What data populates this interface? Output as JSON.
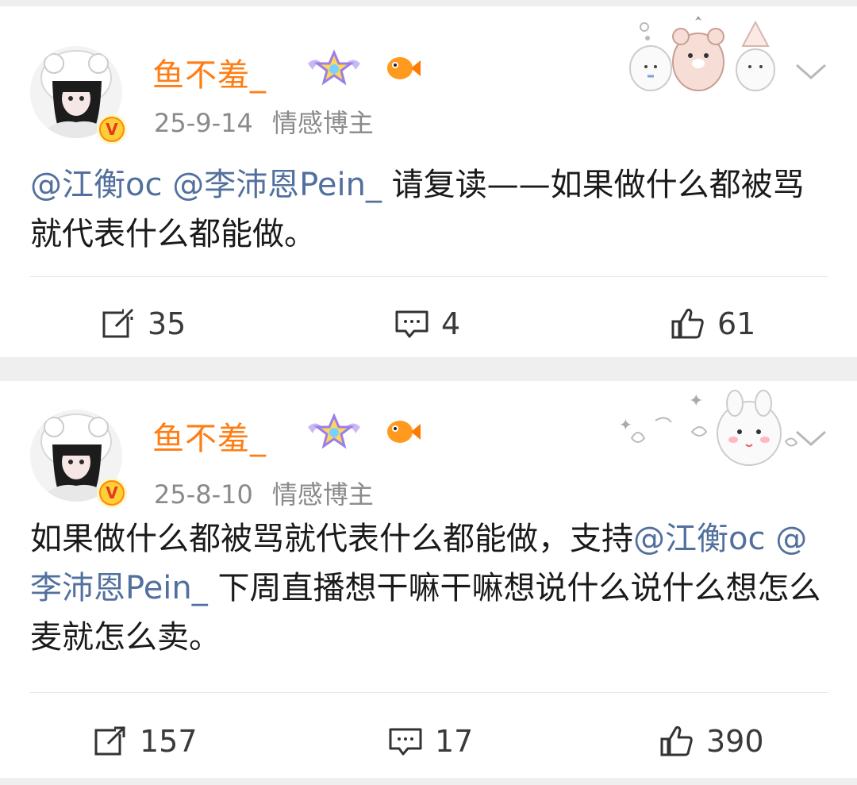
{
  "posts": [
    {
      "username": "鱼不羞_",
      "date": "25-9-14",
      "source": "情感博主",
      "verified_label": "V",
      "content": [
        {
          "type": "mention",
          "text": "@江衡oc"
        },
        {
          "type": "text",
          "text": " "
        },
        {
          "type": "mention",
          "text": "@李沛恩Pein_"
        },
        {
          "type": "text",
          "text": " 请复读——如果做什么都被骂就代表什么都能做。"
        }
      ],
      "reposts": "35",
      "comments": "4",
      "likes": "61"
    },
    {
      "username": "鱼不羞_",
      "date": "25-8-10",
      "source": "情感博主",
      "verified_label": "V",
      "content": [
        {
          "type": "text",
          "text": "如果做什么都被骂就代表什么都能做，支持"
        },
        {
          "type": "mention",
          "text": "@江衡oc"
        },
        {
          "type": "text",
          "text": " "
        },
        {
          "type": "mention",
          "text": "@李沛恩Pein_"
        },
        {
          "type": "text",
          "text": " 下周直播想干嘛干嘛想说什么说什么想怎么麦就怎么卖。"
        }
      ],
      "reposts": "157",
      "comments": "17",
      "likes": "390"
    }
  ],
  "colors": {
    "username": "#ff7d13",
    "mention": "#52709e",
    "meta": "#8a8a8a",
    "text": "#1a1a1a",
    "background": "#f2f2f2"
  },
  "icons": [
    "avatar",
    "verified-badge-icon",
    "star-wing-badge-icon",
    "goldfish-badge-icon",
    "bear-sticker-decoration",
    "chevron-down-icon",
    "repost-icon",
    "comment-icon",
    "like-icon"
  ]
}
